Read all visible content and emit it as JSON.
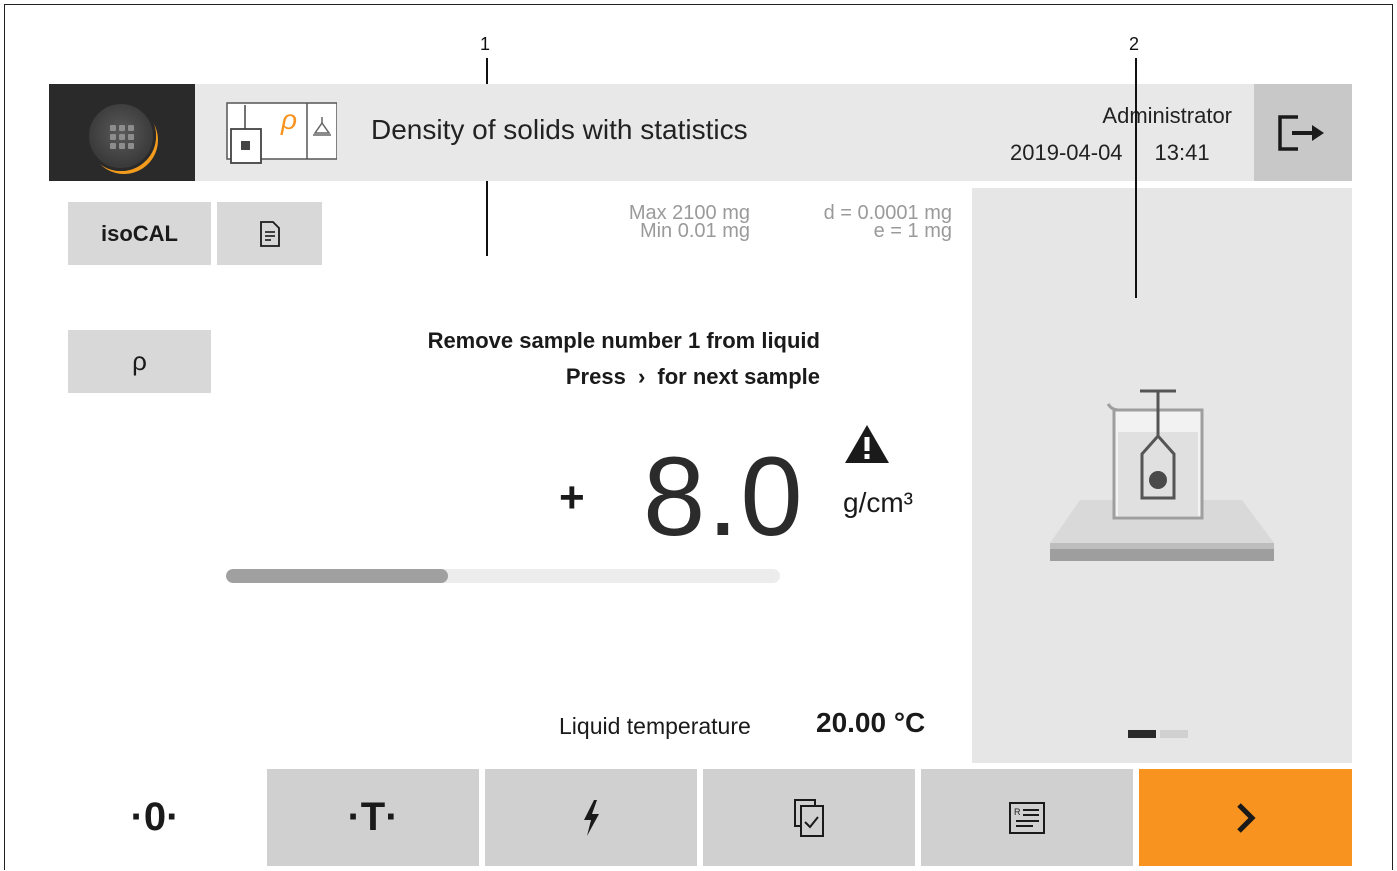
{
  "callouts": {
    "one": "1",
    "two": "2"
  },
  "header": {
    "title": "Density of solids with statistics",
    "user": "Administrator",
    "date": "2019-04-04",
    "time": "13:41",
    "app_icon_symbol": "ρ"
  },
  "left_buttons": {
    "isocal": "isoCAL",
    "rho": "ρ"
  },
  "scale_info": {
    "max": "Max 2100 mg",
    "min": "Min 0.01 mg",
    "d": "d = 0.0001 mg",
    "e": "e = 1 mg"
  },
  "instruction": {
    "line1": "Remove sample number 1 from liquid",
    "line2_pre": "Press",
    "line2_symbol": "›",
    "line2_post": "for next sample"
  },
  "result": {
    "sign": "+",
    "value": "8.0",
    "unit": "g/cm³",
    "progress_fraction": 0.4
  },
  "temperature": {
    "label": "Liquid temperature",
    "value": "20.00 °C"
  },
  "bottom_bar": {
    "zero_label": "·0·",
    "tare_label": "·T·",
    "next_label": "›"
  },
  "pager": {
    "pages": 2,
    "active": 0
  },
  "colors": {
    "accent": "#f7931e",
    "header_bg": "#e8e8e8",
    "dark": "#2a2a2a"
  },
  "icons": [
    "menu-grid-icon",
    "density-app-icon",
    "logout-icon",
    "document-icon",
    "warning-icon",
    "flash-icon",
    "copy-check-icon",
    "report-icon",
    "chevron-right-icon"
  ]
}
